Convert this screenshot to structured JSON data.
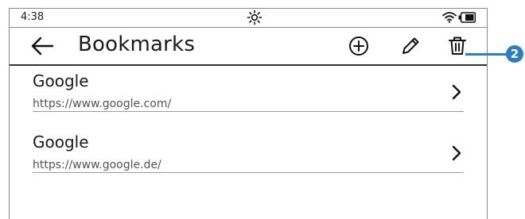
{
  "status_bar": {
    "time": "4:38",
    "brightness_icon": "sun-icon",
    "wifi_icon": "wifi-icon",
    "battery_icon": "battery-icon"
  },
  "toolbar": {
    "title": "Bookmarks",
    "back_icon": "arrow-left-icon",
    "add_icon": "plus-circle-icon",
    "edit_icon": "pencil-icon",
    "delete_icon": "trash-icon"
  },
  "bookmarks": [
    {
      "name": "Google",
      "url": "https://www.google.com/"
    },
    {
      "name": "Google",
      "url": "https://www.google.de/"
    }
  ],
  "callout": {
    "number": "2",
    "color": "#2b7fc1"
  }
}
